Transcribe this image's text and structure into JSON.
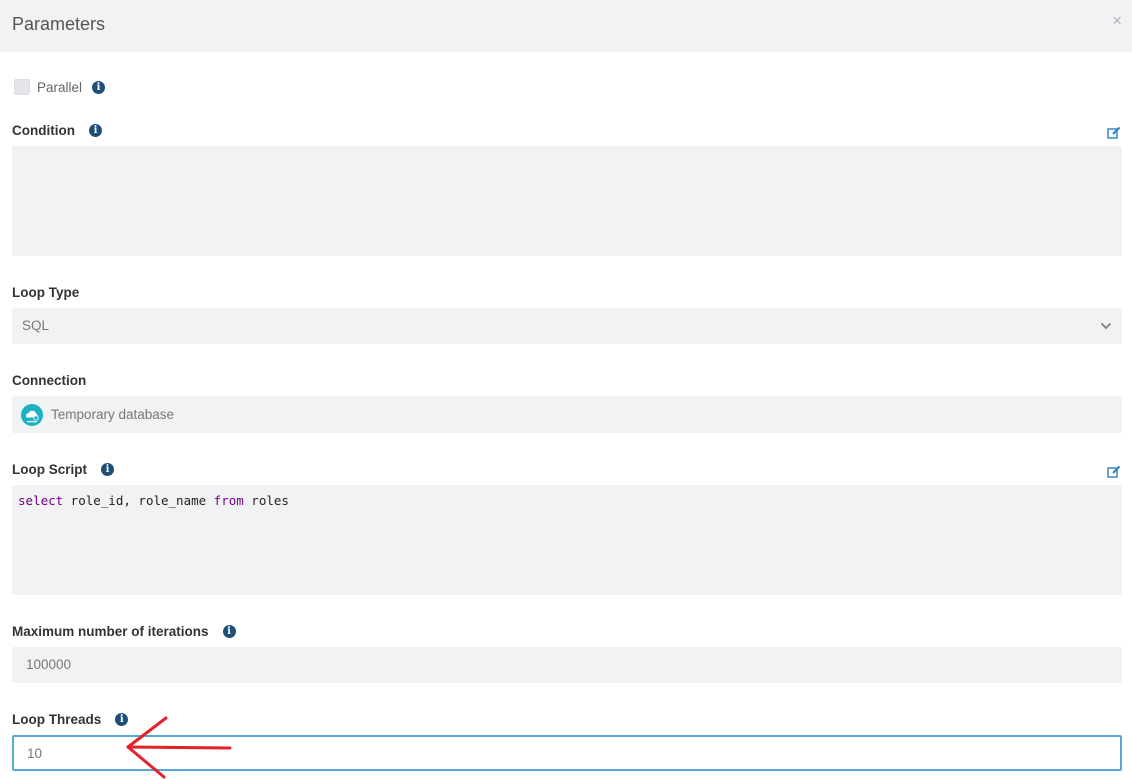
{
  "dialog": {
    "title": "Parameters",
    "close_symbol": "×"
  },
  "parallel": {
    "label": "Parallel",
    "checked": false
  },
  "condition": {
    "label": "Condition",
    "value": ""
  },
  "loop_type": {
    "label": "Loop Type",
    "selected": "SQL"
  },
  "connection": {
    "label": "Connection",
    "value": "Temporary database",
    "logo_icon": "cloud-database-icon",
    "logo_color": "#1bb0c4"
  },
  "loop_script": {
    "label": "Loop Script",
    "tokens": [
      {
        "text": "select",
        "kind": "keyword"
      },
      {
        "text": " role_id, role_name ",
        "kind": "plain"
      },
      {
        "text": "from",
        "kind": "keyword"
      },
      {
        "text": " roles",
        "kind": "plain"
      }
    ]
  },
  "max_iterations": {
    "label": "Maximum number of iterations",
    "value": "100000"
  },
  "loop_threads": {
    "label": "Loop Threads",
    "value": "10"
  },
  "colors": {
    "info_icon": "#1e4f7a",
    "focus_border": "#57a7d8",
    "annotation_arrow": "#e3222a",
    "sql_keyword": "#770088"
  }
}
